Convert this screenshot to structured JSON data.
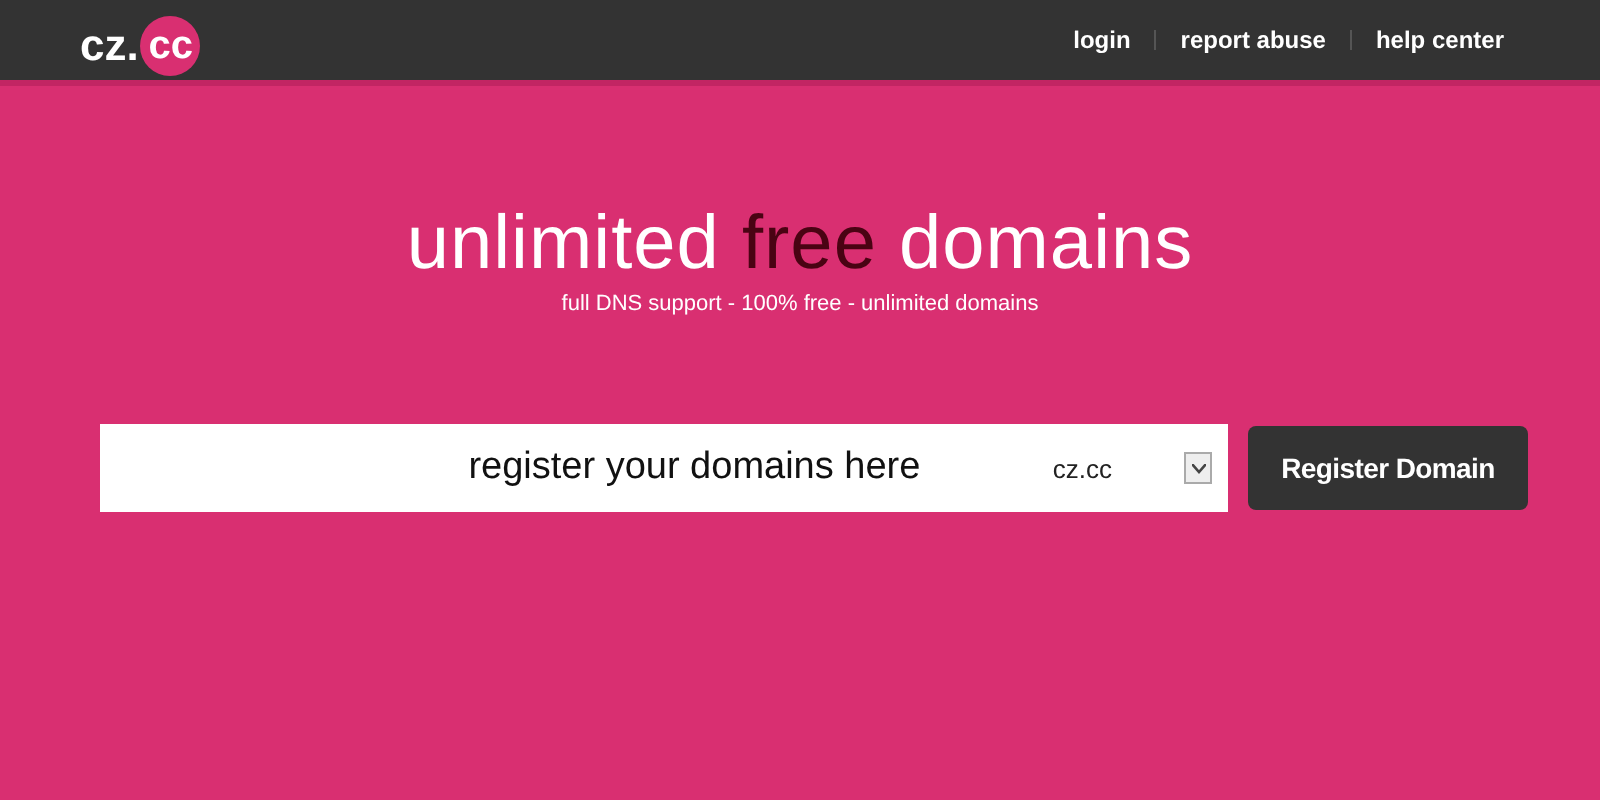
{
  "logo": {
    "text": "cz.",
    "badge": "cc"
  },
  "nav": [
    {
      "label": "login"
    },
    {
      "label": "report abuse"
    },
    {
      "label": "help center"
    }
  ],
  "headline": [
    {
      "text": "unlimited ",
      "emphasis": false
    },
    {
      "text": "free",
      "emphasis": true
    },
    {
      "text": " domains",
      "emphasis": false
    }
  ],
  "tagline": "full DNS support - 100% free - unlimited domains",
  "form": {
    "domain_field": {
      "placeholder": "register your domains here"
    },
    "extension": {
      "value": "cz.cc"
    },
    "submit": "Register Domain"
  }
}
